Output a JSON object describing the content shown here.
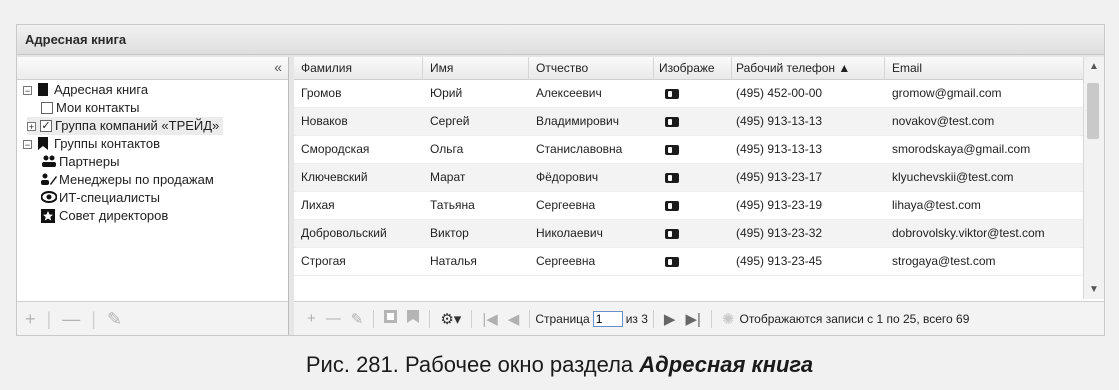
{
  "panel": {
    "title": "Адресная книга"
  },
  "tree": {
    "collapse_label": "«",
    "nodes": [
      {
        "label": "Адресная книга"
      },
      {
        "label": "Мои контакты"
      },
      {
        "label": "Группа компаний «ТРЕЙД»"
      },
      {
        "label": "Группы контактов"
      },
      {
        "label": "Партнеры"
      },
      {
        "label": "Менеджеры по продажам"
      },
      {
        "label": "ИТ-специалисты"
      },
      {
        "label": "Совет директоров"
      }
    ],
    "footer": {
      "add": "+",
      "remove": "—",
      "edit": "✎"
    }
  },
  "grid": {
    "columns": [
      "Фамилия",
      "Имя",
      "Отчество",
      "Изображе",
      "Рабочий телефон ▲",
      "Email"
    ],
    "rows": [
      [
        "Громов",
        "Юрий",
        "Алексеевич",
        "(495) 452-00-00",
        "gromow@gmail.com"
      ],
      [
        "Новаков",
        "Сергей",
        "Владимирович",
        "(495) 913-13-13",
        "novakov@test.com"
      ],
      [
        "Смородская",
        "Ольга",
        "Станиславовна",
        "(495) 913-13-13",
        "smorodskaya@gmail.com"
      ],
      [
        "Ключевский",
        "Марат",
        "Фёдорович",
        "(495) 913-23-17",
        "klyuchevskii@test.com"
      ],
      [
        "Лихая",
        "Татьяна",
        "Сергеевна",
        "(495) 913-23-19",
        "lihaya@test.com"
      ],
      [
        "Добровольский",
        "Виктор",
        "Николаевич",
        "(495) 913-23-32",
        "dobrovolsky.viktor@test.com"
      ],
      [
        "Строгая",
        "Наталья",
        "Сергеевна",
        "(495) 913-23-45",
        "strogaya@test.com"
      ]
    ]
  },
  "pager": {
    "page_label": "Страница",
    "page_value": "1",
    "of_label": "из 3",
    "status": "Отображаются записи с 1 по 25, всего 69"
  },
  "caption": {
    "prefix": "Рис. 281. Рабочее окно раздела ",
    "emphasis": "Адресная книга"
  },
  "icons": [
    "book-icon",
    "checkbox-icon",
    "group-icon",
    "bookmark-icon",
    "people-icon",
    "manager-icon",
    "eye-icon",
    "star-icon",
    "contact-card-icon",
    "settings-icon",
    "refresh-icon"
  ]
}
